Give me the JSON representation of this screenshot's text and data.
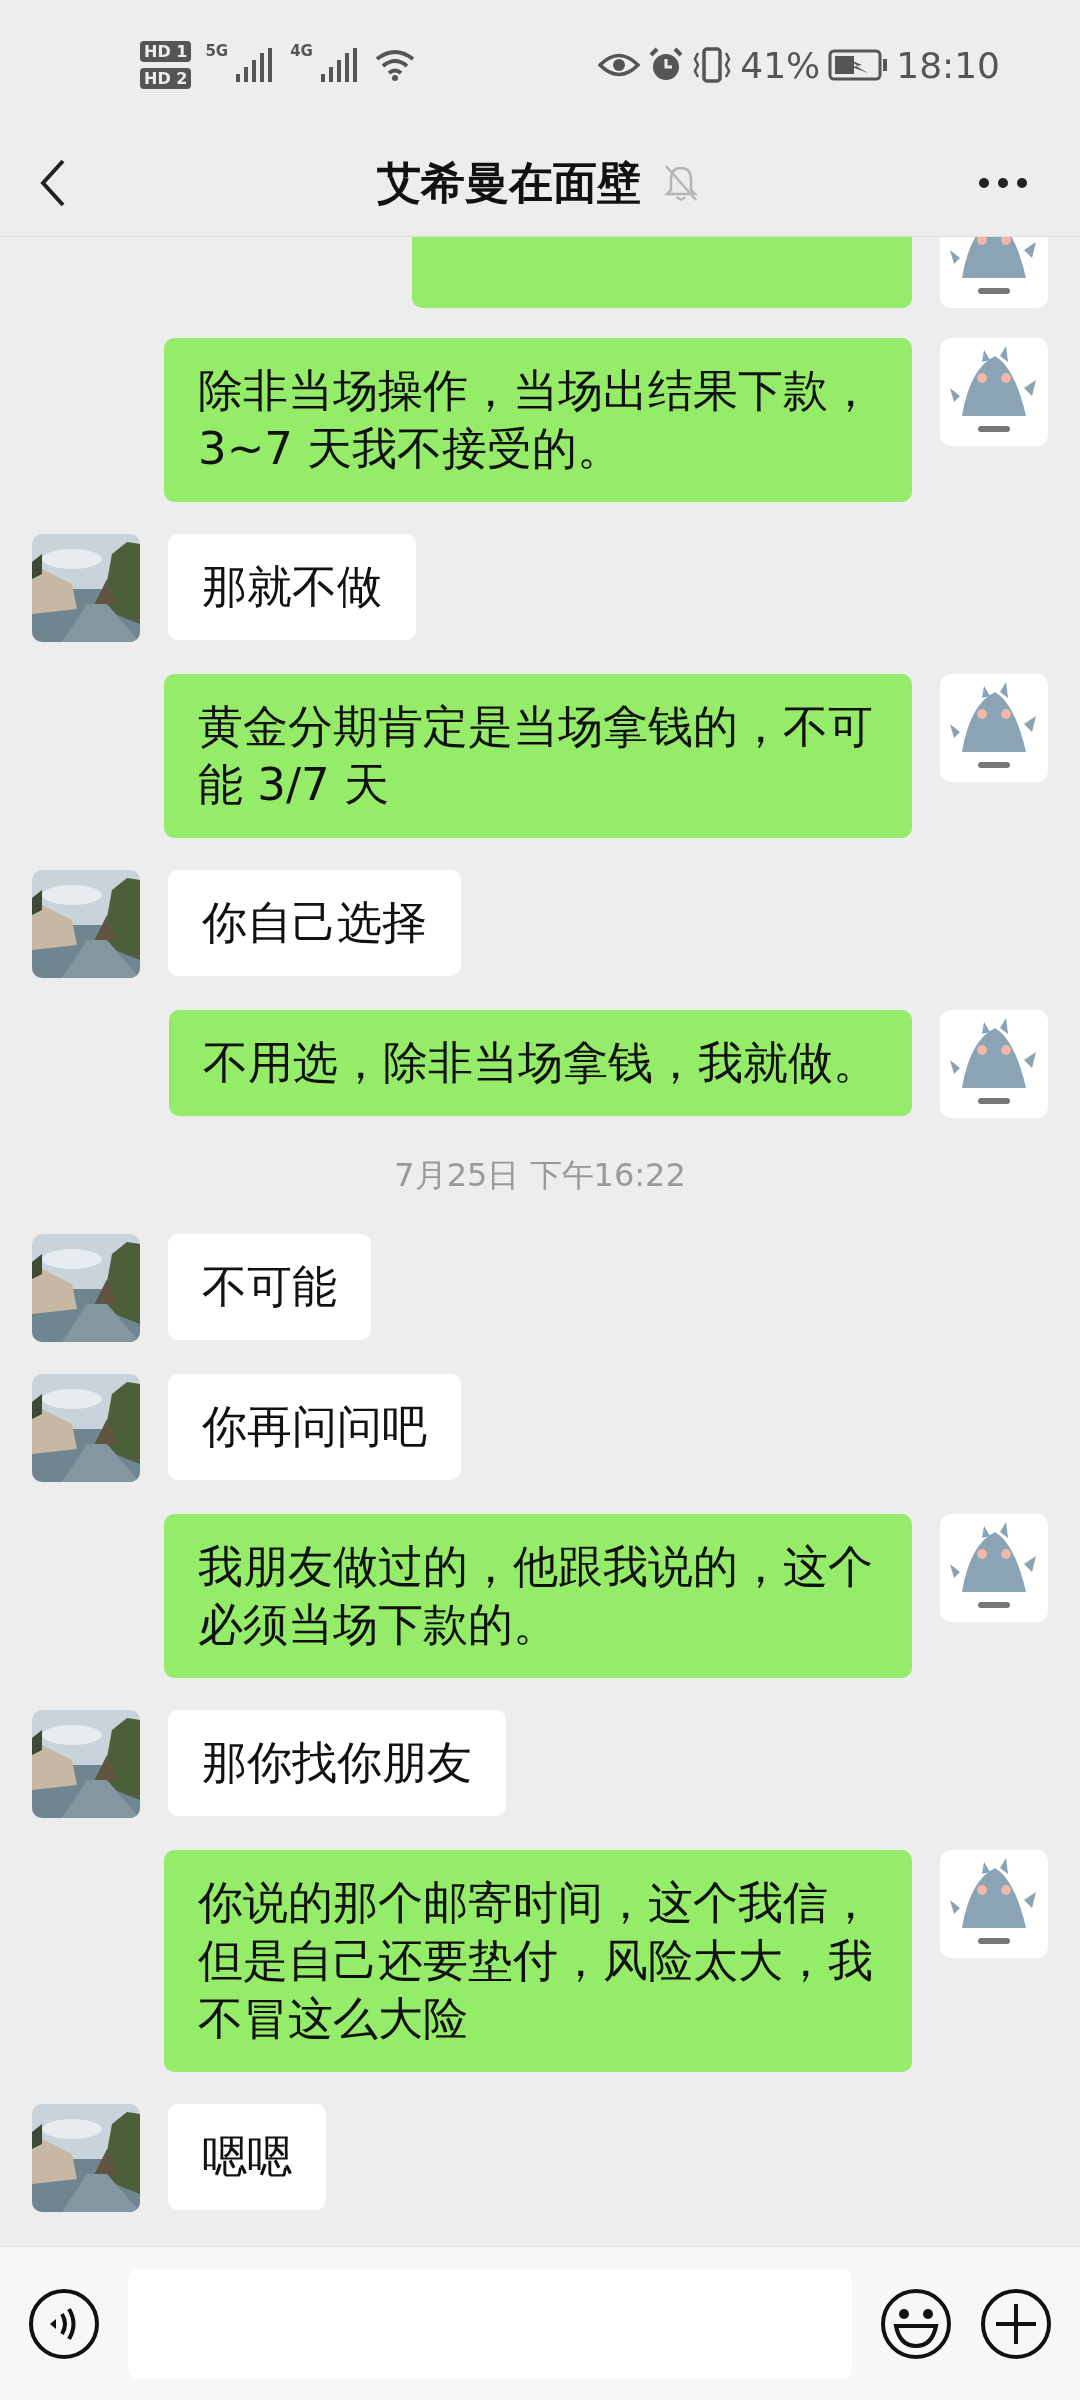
{
  "status_bar": {
    "sim_labels": [
      "HD 1",
      "HD 2"
    ],
    "network_labels": [
      "5G",
      "4G"
    ],
    "battery": "41%",
    "time": "18:10"
  },
  "header": {
    "title": "艾希曼在面壁",
    "muted": true
  },
  "messages": [
    {
      "kind": "cut",
      "outgoing": true
    },
    {
      "kind": "text",
      "outgoing": true,
      "text": "除非当场操作，当场出结果下款，3~7 天我不接受的。"
    },
    {
      "kind": "text",
      "outgoing": false,
      "text": "那就不做"
    },
    {
      "kind": "text",
      "outgoing": true,
      "text": "黄金分期肯定是当场拿钱的，不可能 3/7 天"
    },
    {
      "kind": "text",
      "outgoing": false,
      "text": "你自己选择"
    },
    {
      "kind": "text",
      "outgoing": true,
      "text": "不用选，除非当场拿钱，我就做。"
    },
    {
      "kind": "time",
      "text": "7月25日 下午16:22"
    },
    {
      "kind": "text",
      "outgoing": false,
      "text": "不可能"
    },
    {
      "kind": "text",
      "outgoing": false,
      "text": "你再问问吧"
    },
    {
      "kind": "text",
      "outgoing": true,
      "text": "我朋友做过的，他跟我说的，这个必须当场下款的。"
    },
    {
      "kind": "text",
      "outgoing": false,
      "text": "那你找你朋友"
    },
    {
      "kind": "text",
      "outgoing": true,
      "text": "你说的那个邮寄时间，这个我信，但是自己还要垫付，风险太大，我不冒这么大险"
    },
    {
      "kind": "text",
      "outgoing": false,
      "text": "嗯嗯"
    }
  ]
}
